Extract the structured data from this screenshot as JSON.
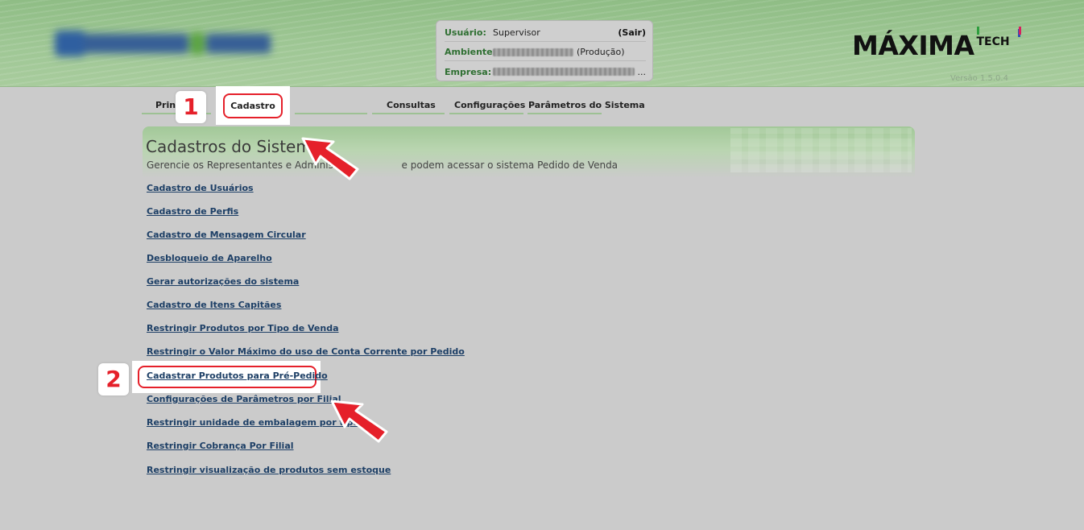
{
  "header": {
    "user": {
      "label": "Usuário:",
      "value": "Supervisor",
      "logout": "(Sair)"
    },
    "ambiente": {
      "label": "Ambiente:",
      "suffix": "(Produção)"
    },
    "empresa": {
      "label": "Empresa:",
      "suffix": "..."
    },
    "brand": {
      "name": "MÁXIMA",
      "suffix": "TECH"
    },
    "version": "Versão 1.5.0.4"
  },
  "tabs": {
    "principal": "Princ",
    "cadastro": "Cadastro",
    "consultas": "Consultas",
    "configuracoes": "Configurações",
    "parametros": "Parâmetros do Sistema"
  },
  "page": {
    "title": "Cadastros do Sistema",
    "description": "Gerencie os Representantes e Administ",
    "description_tail": "e podem acessar o sistema Pedido de Venda"
  },
  "links": [
    "Cadastro de Usuários",
    "Cadastro de Perfis",
    "Cadastro de Mensagem Circular",
    "Desbloqueio de Aparelho",
    "Gerar autorizações do sistema",
    "Cadastro de Itens Capitães",
    "Restringir Produtos por Tipo de Venda",
    "Restringir o Valor Máximo do uso de Conta Corrente por Pedido",
    "Cadastrar Produtos para Pré-Pedido",
    "Configurações de Parâmetros por Filial",
    "Restringir unidade de embalagem por tipo",
    "Restringir Cobrança Por Filial",
    "Restringir visualização de produtos sem estoque"
  ],
  "steps": [
    "1",
    "2"
  ],
  "colors": {
    "accent_red": "#e5202a",
    "header_green": "#9fc795",
    "link_blue": "#1d3f66"
  }
}
